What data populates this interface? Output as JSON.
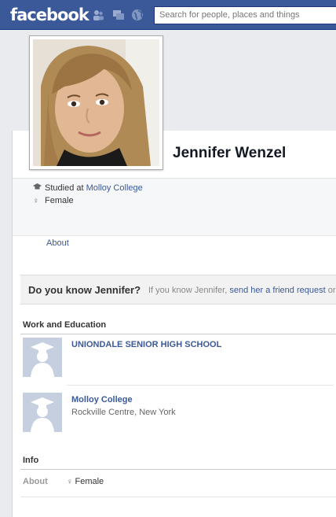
{
  "topbar": {
    "logo": "facebook",
    "search_placeholder": "Search for people, places and things",
    "icons": [
      "friend-requests-icon",
      "messages-icon",
      "notifications-globe-icon"
    ]
  },
  "profile": {
    "name": "Jennifer Wenzel",
    "studied_prefix": "Studied at ",
    "studied_school": "Molloy College",
    "gender": "Female",
    "gender_icon": "♀",
    "school_icon": "graduation-cap-icon"
  },
  "tabs": {
    "about": "About"
  },
  "know": {
    "question": "Do you know Jennifer?",
    "text_prefix": "If you know Jennifer, ",
    "link": "send her a friend request",
    "text_suffix": " or"
  },
  "work_education": {
    "heading": "Work and Education",
    "schools": [
      {
        "name": "UNIONDALE SENIOR HIGH SCHOOL",
        "location": ""
      },
      {
        "name": "Molloy College",
        "location": "Rockville Centre, New York"
      }
    ]
  },
  "info": {
    "heading": "Info",
    "about_label": "About",
    "gender": "Female"
  },
  "colors": {
    "brand": "#3b5998",
    "link": "#3b5998",
    "placeholder_school": "#c5cfe0"
  }
}
